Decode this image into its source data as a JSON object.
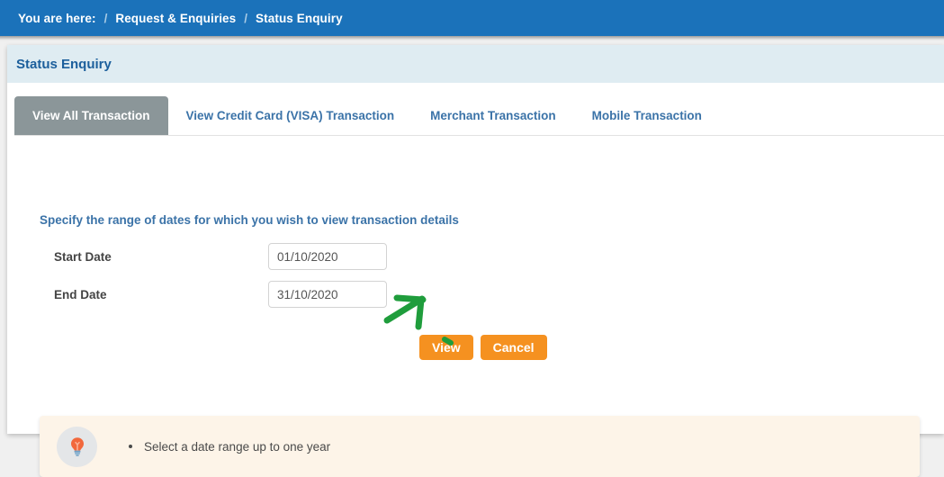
{
  "breadcrumb": {
    "prefix": "You are here:",
    "separator": "/",
    "items": [
      {
        "label": "Request & Enquiries"
      },
      {
        "label": "Status Enquiry"
      }
    ]
  },
  "page": {
    "title": "Status Enquiry"
  },
  "tabs": [
    {
      "label": "View All Transaction",
      "active": true
    },
    {
      "label": "View Credit Card (VISA) Transaction",
      "active": false
    },
    {
      "label": "Merchant Transaction",
      "active": false
    },
    {
      "label": "Mobile Transaction",
      "active": false
    }
  ],
  "form": {
    "instruction": "Specify the range of dates for which you wish to view transaction details",
    "start_date": {
      "label": "Start Date",
      "value": "01/10/2020",
      "placeholder": "dd/mm/yyyy"
    },
    "end_date": {
      "label": "End Date",
      "value": "31/10/2020",
      "placeholder": "dd/mm/yyyy"
    },
    "view_button": "View",
    "cancel_button": "Cancel"
  },
  "tip": {
    "icon": "lightbulb-icon",
    "text": "Select a date range up to one year"
  },
  "annotation": {
    "type": "arrow",
    "target": "View",
    "color": "#1f9d3c"
  },
  "colors": {
    "header_blue": "#1b72ba",
    "title_band": "#dfecf2",
    "title_text": "#1c5f9c",
    "tab_active_bg": "#8b9699",
    "tab_text": "#3b73a8",
    "button_orange": "#f59120",
    "tip_bg": "#fdf4e8",
    "annotation_green": "#1f9d3c"
  }
}
